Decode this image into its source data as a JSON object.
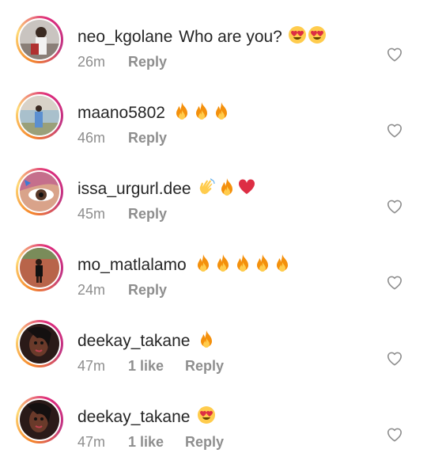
{
  "comments": [
    {
      "username": "neo_kgolane",
      "text": "Who are you?",
      "emojis": [
        "heart-eyes",
        "heart-eyes"
      ],
      "time": "26m",
      "likes": "",
      "reply_label": "Reply"
    },
    {
      "username": "maano5802",
      "text": "",
      "emojis": [
        "fire",
        "fire",
        "fire"
      ],
      "time": "46m",
      "likes": "",
      "reply_label": "Reply"
    },
    {
      "username": "issa_urgurl.dee",
      "text": "",
      "emojis": [
        "waving-hand",
        "fire",
        "red-heart"
      ],
      "time": "45m",
      "likes": "",
      "reply_label": "Reply"
    },
    {
      "username": "mo_matlalamo",
      "text": "",
      "emojis": [
        "fire",
        "fire",
        "fire",
        "fire",
        "fire"
      ],
      "time": "24m",
      "likes": "",
      "reply_label": "Reply"
    },
    {
      "username": "deekay_takane",
      "text": "",
      "emojis": [
        "fire"
      ],
      "time": "47m",
      "likes": "1 like",
      "reply_label": "Reply"
    },
    {
      "username": "deekay_takane",
      "text": "",
      "emojis": [
        "heart-eyes"
      ],
      "time": "47m",
      "likes": "1 like",
      "reply_label": "Reply"
    }
  ],
  "colors": {
    "text": "#262626",
    "muted": "#8e8e8e",
    "ring": "#dd2a7b",
    "heart_outline": "#8e8e8e"
  }
}
